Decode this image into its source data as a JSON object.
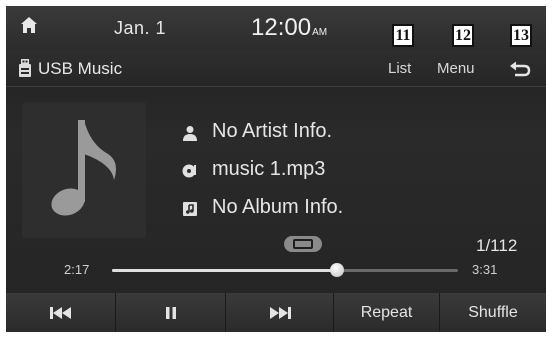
{
  "status_bar": {
    "date": "Jan.  1",
    "time": "12:00",
    "ampm": "AM"
  },
  "markers": {
    "list": "11",
    "menu": "12",
    "back": "13"
  },
  "title_bar": {
    "source_title": "USB Music",
    "list_label": "List",
    "menu_label": "Menu"
  },
  "track": {
    "artist": "No Artist Info.",
    "title": "music 1.mp3",
    "album": "No Album Info.",
    "track_counter": "1/112"
  },
  "playback": {
    "elapsed": "2:17",
    "total": "3:31",
    "progress": 0.65
  },
  "controls": {
    "repeat_label": "Repeat",
    "shuffle_label": "Shuffle"
  },
  "icons": {
    "home": "home-icon",
    "usb": "usb-icon",
    "back": "back-icon",
    "artist": "person-icon",
    "title": "music-disc-icon",
    "album": "album-icon",
    "repeat_mode": "repeat-icon",
    "previous": "previous-track-icon",
    "pause": "pause-icon",
    "next": "next-track-icon"
  }
}
